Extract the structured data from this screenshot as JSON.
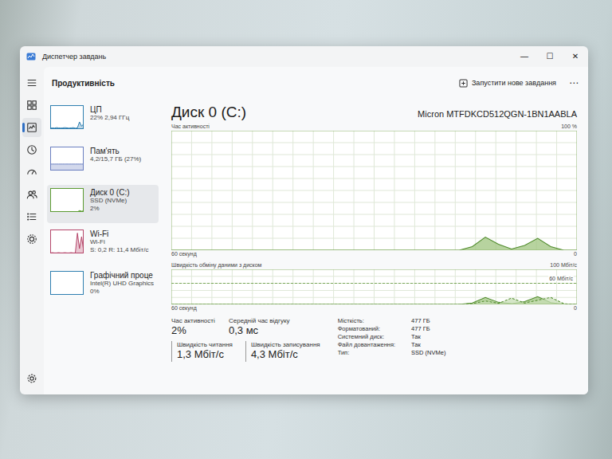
{
  "window": {
    "title": "Диспетчер завдань",
    "controls": [
      "—",
      "☐",
      "✕"
    ]
  },
  "nav": [
    {
      "kind": "menu",
      "selected": false
    },
    {
      "kind": "processes",
      "selected": false
    },
    {
      "kind": "performance",
      "selected": true
    },
    {
      "kind": "history",
      "selected": false
    },
    {
      "kind": "startup",
      "selected": false
    },
    {
      "kind": "users",
      "selected": false
    },
    {
      "kind": "details",
      "selected": false
    },
    {
      "kind": "services",
      "selected": false
    }
  ],
  "settings": {
    "kind": "settings",
    "selected": false
  },
  "header": {
    "title": "Продуктивність",
    "action": "Запустити нове завдання",
    "more": "⋯"
  },
  "resources": [
    {
      "name": "ЦП",
      "lines": [
        "22% 2,94 ГГц"
      ],
      "selected": false,
      "color": "#2f7fb0",
      "graph": [
        4,
        5,
        4,
        6,
        5,
        4,
        5,
        6,
        5,
        4,
        5,
        6,
        4,
        5,
        30,
        12,
        22
      ]
    },
    {
      "name": "Пам'ять",
      "lines": [
        "4,2/15,7 ГБ (27%)"
      ],
      "selected": false,
      "color": "#6a7fc0",
      "graph": [
        27,
        27,
        27,
        27,
        27,
        27,
        27,
        27,
        27,
        27,
        27,
        27,
        27,
        27,
        27,
        27,
        27
      ]
    },
    {
      "name": "Диск 0 (C:)",
      "lines": [
        "SSD (NVMe)",
        "2%"
      ],
      "selected": true,
      "color": "#5a9a30",
      "graph": [
        0,
        0,
        0,
        0,
        0,
        0,
        0,
        0,
        0,
        0,
        0,
        0,
        0,
        0,
        6,
        3,
        5
      ]
    },
    {
      "name": "Wi-Fi",
      "lines": [
        "Wi-Fi",
        "S: 0,2 R: 11,4 Мбіт/с"
      ],
      "selected": false,
      "color": "#b5476b",
      "graph": [
        2,
        3,
        2,
        2,
        3,
        2,
        2,
        3,
        2,
        2,
        3,
        2,
        2,
        85,
        20,
        70,
        10
      ]
    },
    {
      "name": "Графічний проце",
      "lines": [
        "Intel(R) UHD Graphics",
        "0%"
      ],
      "selected": false,
      "color": "#2f7fb0",
      "graph": [
        0,
        0,
        0,
        0,
        0,
        0,
        0,
        0,
        0,
        0,
        0,
        0,
        0,
        0,
        0,
        0,
        0
      ]
    }
  ],
  "detail": {
    "title": "Диск 0 (C:)",
    "model": "Micron MTFDKCD512QGN-1BN1AABLA",
    "activity_chart": {
      "label": "Час активності",
      "max_label": "100 %",
      "time_label": "60 секунд",
      "end_label": "0",
      "max": 100,
      "series": [
        [
          0,
          0,
          0,
          0,
          0,
          0,
          0,
          0,
          0,
          0,
          0,
          0,
          0,
          0,
          0,
          0,
          0,
          0,
          0,
          0,
          0,
          0,
          0,
          3,
          11,
          5,
          1,
          4,
          10,
          3,
          0,
          0
        ]
      ]
    },
    "transfer_chart": {
      "label": "Швидкість обміну даними з диском",
      "max_label": "100 Мбіт/с",
      "ref_label": "60 Мбіт/с",
      "ref": 60,
      "max": 100,
      "time_label": "60 секунд",
      "end_label": "0",
      "series": [
        [
          0,
          0,
          0,
          0,
          0,
          0,
          0,
          0,
          0,
          0,
          0,
          0,
          0,
          0,
          0,
          0,
          0,
          0,
          0,
          0,
          0,
          0,
          0,
          4,
          20,
          6,
          2,
          8,
          22,
          5,
          0,
          0
        ],
        [
          0,
          0,
          0,
          0,
          0,
          0,
          0,
          0,
          0,
          0,
          0,
          0,
          0,
          0,
          0,
          0,
          0,
          0,
          0,
          0,
          0,
          0,
          0,
          2,
          10,
          3,
          18,
          4,
          12,
          20,
          2,
          0
        ]
      ]
    }
  },
  "stats": [
    {
      "label": "Час активності",
      "value": "2%"
    },
    {
      "label": "Середній час відгуку",
      "value": "0,3 мс"
    }
  ],
  "speeds": [
    {
      "label": "Швидкість читання",
      "value": "1,3 Мбіт/с"
    },
    {
      "label": "Швидкість записування",
      "value": "4,3 Мбіт/с"
    }
  ],
  "properties": [
    {
      "label": "Місткість:",
      "value": "477 ГБ"
    },
    {
      "label": "Форматований:",
      "value": "477 ГБ"
    },
    {
      "label": "Системний диск:",
      "value": "Так"
    },
    {
      "label": "Файл довантаження:",
      "value": "Так"
    },
    {
      "label": "Тип:",
      "value": "SSD (NVMe)"
    }
  ]
}
